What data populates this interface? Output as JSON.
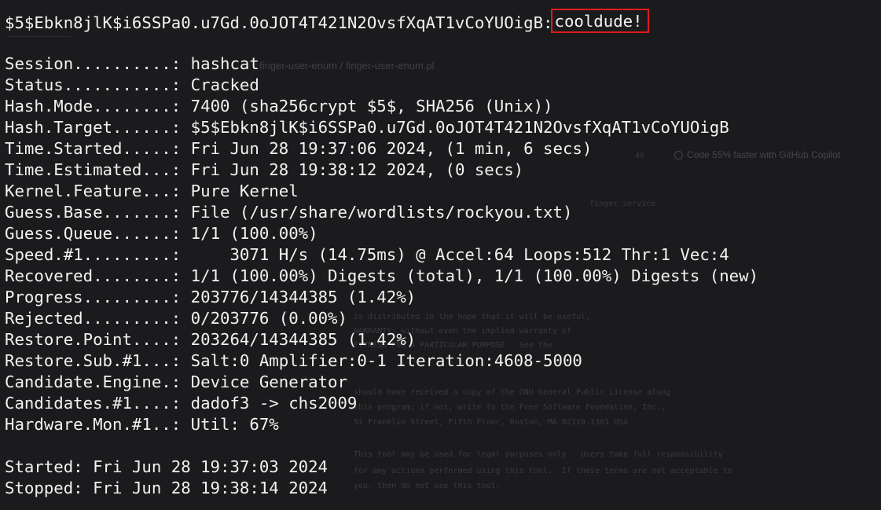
{
  "cracked_hash": {
    "hash": "$5$Ebkn8jlK$i6SSPa0.u7Gd.0oJOT4T421N2OvsfXqAT1vCoYUOigB:",
    "password": "cooldude!"
  },
  "status_lines": [
    {
      "key": "Session..........:",
      "value": " hashcat"
    },
    {
      "key": "Status...........:",
      "value": " Cracked"
    },
    {
      "key": "Hash.Mode........:",
      "value": " 7400 (sha256crypt $5$, SHA256 (Unix))"
    },
    {
      "key": "Hash.Target......:",
      "value": " $5$Ebkn8jlK$i6SSPa0.u7Gd.0oJOT4T421N2OvsfXqAT1vCoYUOigB"
    },
    {
      "key": "Time.Started.....:",
      "value": " Fri Jun 28 19:37:06 2024, (1 min, 6 secs)"
    },
    {
      "key": "Time.Estimated...:",
      "value": " Fri Jun 28 19:38:12 2024, (0 secs)"
    },
    {
      "key": "Kernel.Feature...:",
      "value": " Pure Kernel"
    },
    {
      "key": "Guess.Base.......:",
      "value": " File (/usr/share/wordlists/rockyou.txt)"
    },
    {
      "key": "Guess.Queue......:",
      "value": " 1/1 (100.00%)"
    },
    {
      "key": "Speed.#1.........:",
      "value": "     3071 H/s (14.75ms) @ Accel:64 Loops:512 Thr:1 Vec:4"
    },
    {
      "key": "Recovered........:",
      "value": " 1/1 (100.00%) Digests (total), 1/1 (100.00%) Digests (new)"
    },
    {
      "key": "Progress.........:",
      "value": " 203776/14344385 (1.42%)"
    },
    {
      "key": "Rejected.........:",
      "value": " 0/203776 (0.00%)"
    },
    {
      "key": "Restore.Point....:",
      "value": " 203264/14344385 (1.42%)"
    },
    {
      "key": "Restore.Sub.#1...:",
      "value": " Salt:0 Amplifier:0-1 Iteration:4608-5000"
    },
    {
      "key": "Candidate.Engine.:",
      "value": " Device Generator"
    },
    {
      "key": "Candidates.#1....:",
      "value": " dadof3 -> chs2009"
    },
    {
      "key": "Hardware.Mon.#1..:",
      "value": " Util: 67%"
    }
  ],
  "footer_lines": [
    {
      "key": "Started:",
      "value": " Fri Jun 28 19:37:03 2024"
    },
    {
      "key": "Stopped:",
      "value": " Fri Jun 28 19:38:14 2024"
    }
  ],
  "background_ghost": {
    "breadcrumb": "finger-user-enum / finger-user-enum.pl",
    "copilot_text": "Code 55% faster with GitHub Copilot",
    "line_count": "46",
    "code_lines": [
      "finger service",
      "is distributed in the hope that it will be useful,",
      "WARRANTY; without even the implied warranty of",
      "FITNESS FOR A PARTICULAR PURPOSE.  See the",
      "should have received a copy of the GNU General Public License along",
      "this program; if not, write to the Free Software Foundation, Inc.,",
      "51 Franklin Street, Fifth Floor, Boston, MA 02110-1301 USA",
      "This tool may be used for legal purposes only.  Users take full responsibility",
      "for any actions performed using this tool.  If these terms are not acceptable to",
      "you, then do not use this tool."
    ]
  },
  "colors": {
    "background": "#1b1b1d",
    "text": "#f2f2f2",
    "highlight_border": "#e01b1b"
  }
}
